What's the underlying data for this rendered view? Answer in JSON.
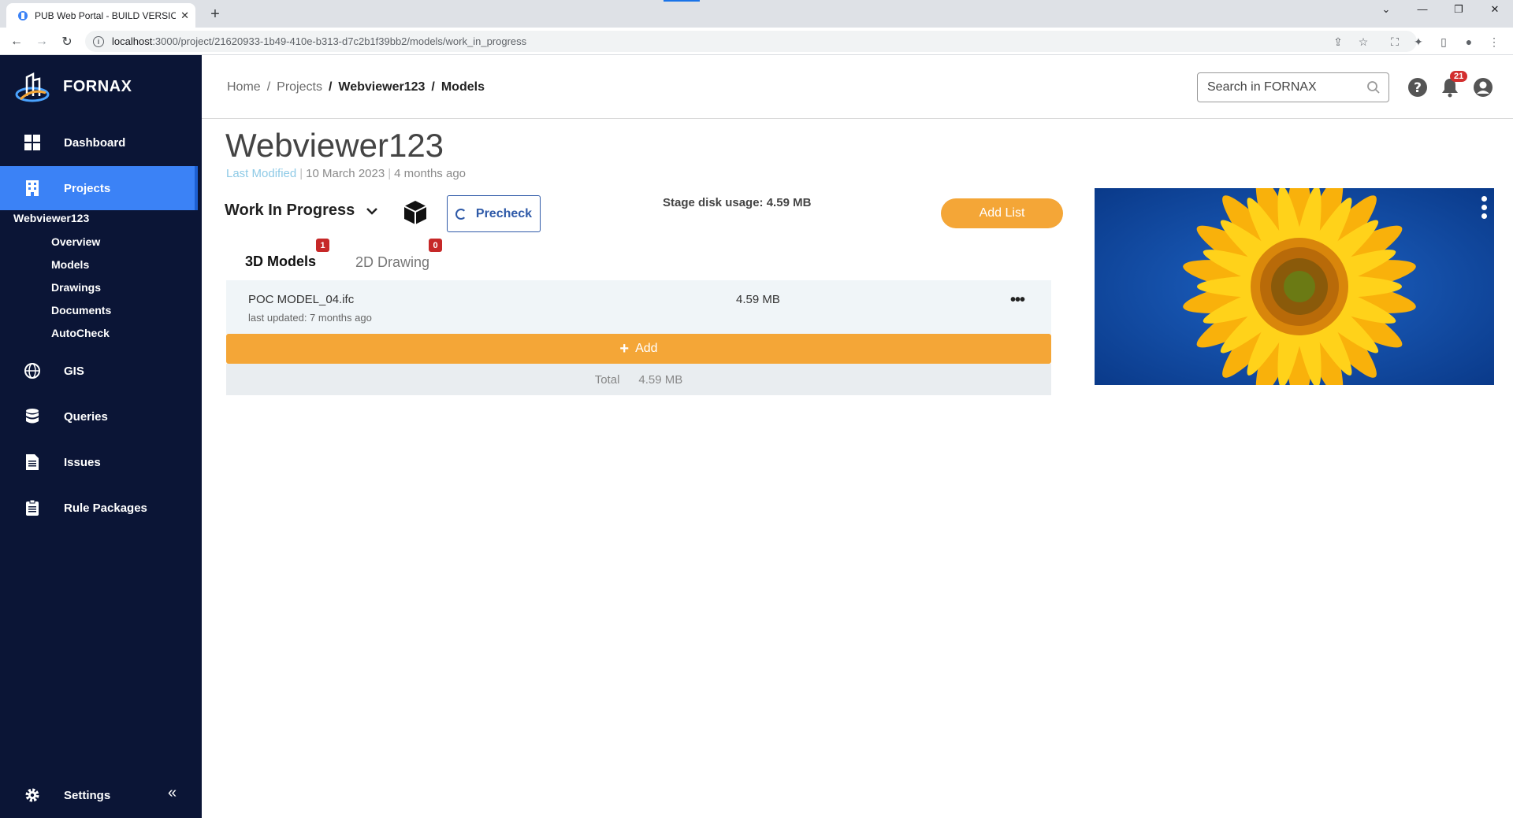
{
  "browser": {
    "tab_title": "PUB Web Portal - BUILD VERSION",
    "url_host": "localhost",
    "url_path": ":3000/project/21620933-1b49-410e-b313-d7c2b1f39bb2/models/work_in_progress"
  },
  "sidebar": {
    "brand": "FORNAX",
    "items": [
      {
        "label": "Dashboard",
        "icon": "grid-icon"
      },
      {
        "label": "Projects",
        "icon": "building-icon"
      },
      {
        "label": "GIS",
        "icon": "globe-icon"
      },
      {
        "label": "Queries",
        "icon": "database-icon"
      },
      {
        "label": "Issues",
        "icon": "document-icon"
      },
      {
        "label": "Rule Packages",
        "icon": "clipboard-icon"
      }
    ],
    "project": "Webviewer123",
    "sub_items": [
      "Overview",
      "Models",
      "Drawings",
      "Documents",
      "AutoCheck"
    ],
    "settings": "Settings"
  },
  "header": {
    "breadcrumb": [
      "Home",
      "/",
      "Projects",
      "/",
      "Webviewer123",
      "/",
      "Models"
    ],
    "search_placeholder": "Search in FORNAX",
    "notification_count": "21"
  },
  "main": {
    "title": "Webviewer123",
    "last_modified_label": "Last Modified",
    "date": "10 March 2023",
    "relative": "4 months ago",
    "stage": "Work In Progress",
    "precheck_label": "Precheck",
    "disk_usage": "Stage disk usage: 4.59 MB",
    "add_list_label": "Add List",
    "tabs": [
      {
        "label": "3D Models",
        "count": "1"
      },
      {
        "label": "2D Drawing",
        "count": "0"
      }
    ],
    "models": [
      {
        "name": "POC MODEL_04.ifc",
        "updated": "last updated: 7 months ago",
        "size": "4.59 MB",
        "menu": "•••"
      }
    ],
    "add_label": "Add",
    "total_label": "Total",
    "total_value": "4.59 MB"
  },
  "colors": {
    "sidebar_bg": "#0b1536",
    "active_nav": "#3b82f6",
    "accent_orange": "#f4a637",
    "precheck_blue": "#2f5aa8",
    "badge_red": "#c62828"
  }
}
